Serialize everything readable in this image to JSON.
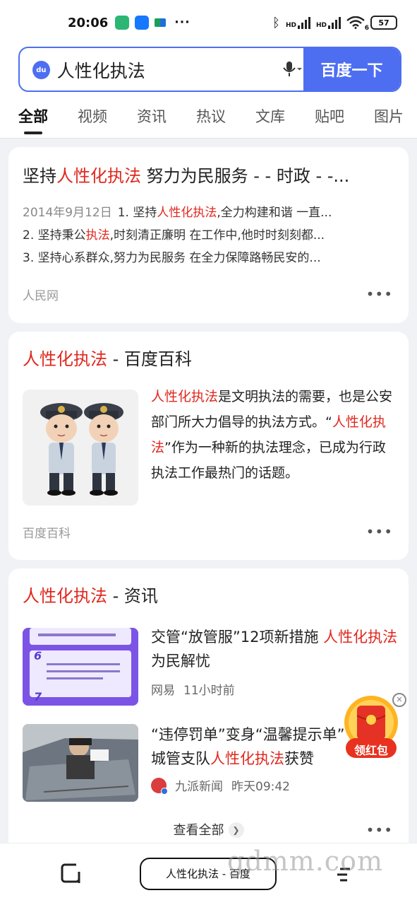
{
  "status_bar": {
    "time": "20:06",
    "dots": "···",
    "network_label_1": "HD",
    "network_label_2": "HD",
    "wifi_label": "6",
    "battery": "57"
  },
  "search": {
    "query": "人性化执法",
    "logo_text": "du",
    "button_label": "百度一下"
  },
  "tabs": [
    "全部",
    "视频",
    "资讯",
    "热议",
    "文库",
    "贴吧",
    "图片"
  ],
  "result1": {
    "title_pre": "坚持",
    "title_hl": "人性化执法",
    "title_post": " 努力为民服务 - - 时政 - -...",
    "date": "2014年9月12日",
    "line1_pre": "1. 坚持",
    "line1_hl": "人性化执法",
    "line1_post": ",全力构建和谐 一直...",
    "line2_pre": "2. 坚持秉公",
    "line2_hl": "执法",
    "line2_post": ",时刻清正廉明 在工作中,他时时刻刻都...",
    "line3": "3. 坚持心系群众,努力为民服务 在全力保障路畅民安的...",
    "source": "人民网",
    "more": "•••"
  },
  "baike": {
    "title_hl": "人性化执法",
    "title_post": " - 百度百科",
    "text_hl1": "人性化执法",
    "text_mid1": "是文明执法的需要，也是公安部门所大力倡导的执法方式。“",
    "text_hl2": "人性化执法",
    "text_post": "”作为一种新的执法理念，已成为行政执法工作最热门的话题。",
    "source": "百度百科",
    "more": "•••"
  },
  "news": {
    "title_hl": "人性化执法",
    "title_post": " - 资讯",
    "items": [
      {
        "title_pre": "交管“放管服”12项新措施 ",
        "title_hl": "人性化执法",
        "title_post": "为民解忧",
        "source": "网易",
        "time": "11小时前",
        "thumb_num1": "6",
        "thumb_num2": "7"
      },
      {
        "title_pre": "“违停罚单”变身“温馨提示单” ",
        "title_pre2": "城管支队",
        "title_hl": "人性化执法",
        "title_post": "获赞",
        "source": "九派新闻",
        "time": "昨天09:42"
      }
    ],
    "see_all": "查看全部",
    "more": "•••"
  },
  "redpack": {
    "label": "领红包",
    "close": "✕"
  },
  "bottom": {
    "pill_text": "人性化执法 - 百度"
  },
  "watermark": "gdmm.com"
}
